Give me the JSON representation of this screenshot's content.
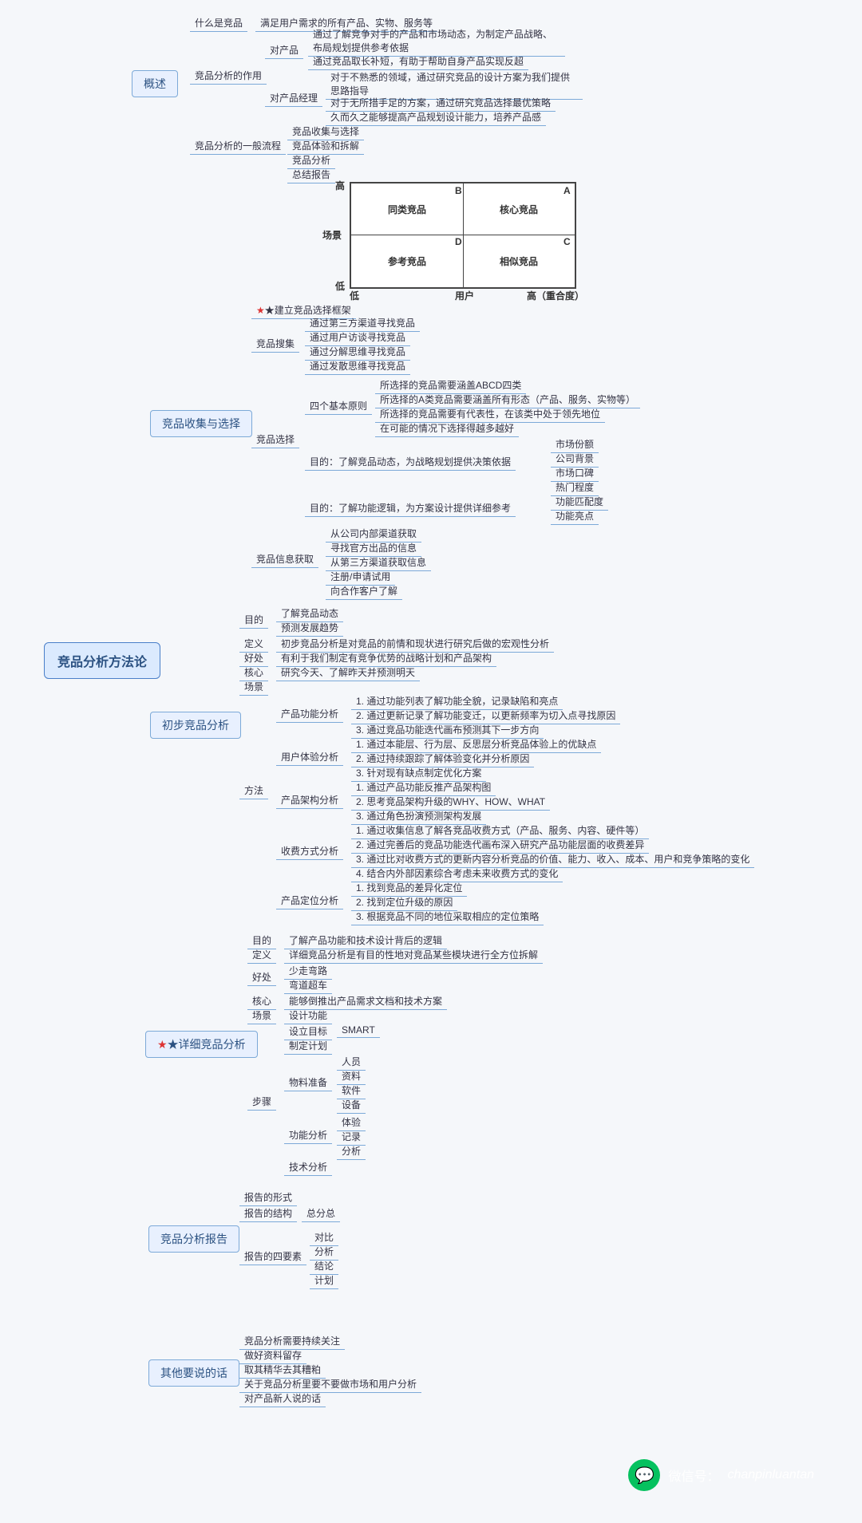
{
  "root": "竞品分析方法论",
  "b": {
    "b1": "概述",
    "b2": "竞品收集与选择",
    "b3": "初步竞品分析",
    "b4": "★详细竞品分析",
    "b5": "竞品分析报告",
    "b6": "其他要说的话"
  },
  "o": {
    "w": "什么是竞品",
    "wd": "满足用户需求的所有产品、实物、服务等",
    "r": "竞品分析的作用",
    "rp": "对产品",
    "rpm": "对产品经理",
    "r1": "通过了解竞争对手的产品和市场动态，为制定产品战略、布局规划提供参考依据",
    "r2": "通过竞品取长补短，有助于帮助自身产品实现反超",
    "r3": "对于不熟悉的领域，通过研究竞品的设计方案为我们提供思路指导",
    "r4": "对于无所措手足的方案，通过研究竞品选择最优策略",
    "r5": "久而久之能够提高产品规划设计能力，培养产品感",
    "f": "竞品分析的一般流程",
    "f1": "竞品收集与选择",
    "f2": "竞品体验和拆解",
    "f3": "竞品分析",
    "f4": "总结报告"
  },
  "c": {
    "frame": "★建立竞品选择框架",
    "s": "竞品搜集",
    "s1": "通过第三方渠道寻找竞品",
    "s2": "通过用户访谈寻找竞品",
    "s3": "通过分解思维寻找竞品",
    "s4": "通过发散思维寻找竞品",
    "sel": "竞品选择",
    "p": "四个基本原则",
    "p1": "所选择的竞品需要涵盖ABCD四类",
    "p2": "所选择的A类竞品需要涵盖所有形态（产品、服务、实物等）",
    "p3": "所选择的竞品需要有代表性，在该类中处于领先地位",
    "p4": "在可能的情况下选择得越多越好",
    "g1": "目的：了解竞品动态，为战略规划提供决策依据",
    "g1a": "市场份额",
    "g1b": "公司背景",
    "g1c": "市场口碑",
    "g1d": "热门程度",
    "g2": "目的：了解功能逻辑，为方案设计提供详细参考",
    "g2a": "功能匹配度",
    "g2b": "功能亮点",
    "info": "竞品信息获取",
    "i1": "从公司内部渠道获取",
    "i2": "寻找官方出品的信息",
    "i3": "从第三方渠道获取信息",
    "i4": "注册/申请试用",
    "i5": "向合作客户了解"
  },
  "pre": {
    "aim": "目的",
    "a1": "了解竞品动态",
    "a2": "预测发展趋势",
    "def": "定义",
    "defv": "初步竞品分析是对竞品的前情和现状进行研究后做的宏观性分析",
    "ben": "好处",
    "benv": "有利于我们制定有竞争优势的战略计划和产品架构",
    "core": "核心",
    "corev": "研究今天、了解昨天并预测明天",
    "scene": "场景",
    "m": "方法",
    "mf": "产品功能分析",
    "mu": "用户体验分析",
    "ma": "产品架构分析",
    "mc": "收费方式分析",
    "mp": "产品定位分析",
    "mf1": "1. 通过功能列表了解功能全貌，记录缺陷和亮点",
    "mf2": "2. 通过更新记录了解功能变迁，以更新频率为切入点寻找原因",
    "mf3": "3. 通过竞品功能迭代画布预测其下一步方向",
    "mu1": "1. 通过本能层、行为层、反思层分析竞品体验上的优缺点",
    "mu2": "2. 通过持续跟踪了解体验变化并分析原因",
    "mu3": "3. 针对现有缺点制定优化方案",
    "ma1": "1. 通过产品功能反推产品架构图",
    "ma2": "2. 思考竞品架构升级的WHY、HOW、WHAT",
    "ma3": "3. 通过角色扮演预测架构发展",
    "mc1": "1. 通过收集信息了解各竞品收费方式（产品、服务、内容、硬件等）",
    "mc2": "2. 通过完善后的竞品功能迭代画布深入研究产品功能层面的收费差异",
    "mc3": "3. 通过比对收费方式的更新内容分析竞品的价值、能力、收入、成本、用户和竞争策略的变化",
    "mc4": "4. 结合内外部因素综合考虑未来收费方式的变化",
    "mp1": "1. 找到竞品的差异化定位",
    "mp2": "2. 找到定位升级的原因",
    "mp3": "3. 根据竞品不同的地位采取相应的定位策略"
  },
  "det": {
    "aim": "目的",
    "aimv": "了解产品功能和技术设计背后的逻辑",
    "def": "定义",
    "defv": "详细竞品分析是有目的性地对竞品某些模块进行全方位拆解",
    "ben": "好处",
    "b1": "少走弯路",
    "b2": "弯道超车",
    "core": "核心",
    "corev": "能够倒推出产品需求文档和技术方案",
    "scene": "场景",
    "scenev": "设计功能",
    "step": "步骤",
    "s1": "设立目标",
    "s1v": "SMART",
    "s2": "制定计划",
    "s3": "物料准备",
    "s3a": "人员",
    "s3b": "资料",
    "s3c": "软件",
    "s3d": "设备",
    "s4": "功能分析",
    "s4a": "体验",
    "s4b": "记录",
    "s4c": "分析",
    "s5": "技术分析"
  },
  "rep": {
    "f": "报告的形式",
    "s": "报告的结构",
    "sv": "总分总",
    "e": "报告的四要素",
    "e1": "对比",
    "e2": "分析",
    "e3": "结论",
    "e4": "计划"
  },
  "oth": {
    "o1": "竞品分析需要持续关注",
    "o2": "做好资料留存",
    "o3": "取其精华去其糟粕",
    "o4": "关于竞品分析里要不要做市场和用户分析",
    "o5": "对产品新人说的话"
  },
  "quad": {
    "t1": "同类竞品",
    "t2": "核心竞品",
    "t3": "参考竞品",
    "t4": "相似竞品",
    "a": "A",
    "b": "B",
    "c": "C",
    "d": "D",
    "hi": "高",
    "lo": "低",
    "x": "用户",
    "y": "场景",
    "xr": "高（重合度）"
  },
  "wx": {
    "label": "微信号：",
    "id": "chanpinluantan"
  }
}
